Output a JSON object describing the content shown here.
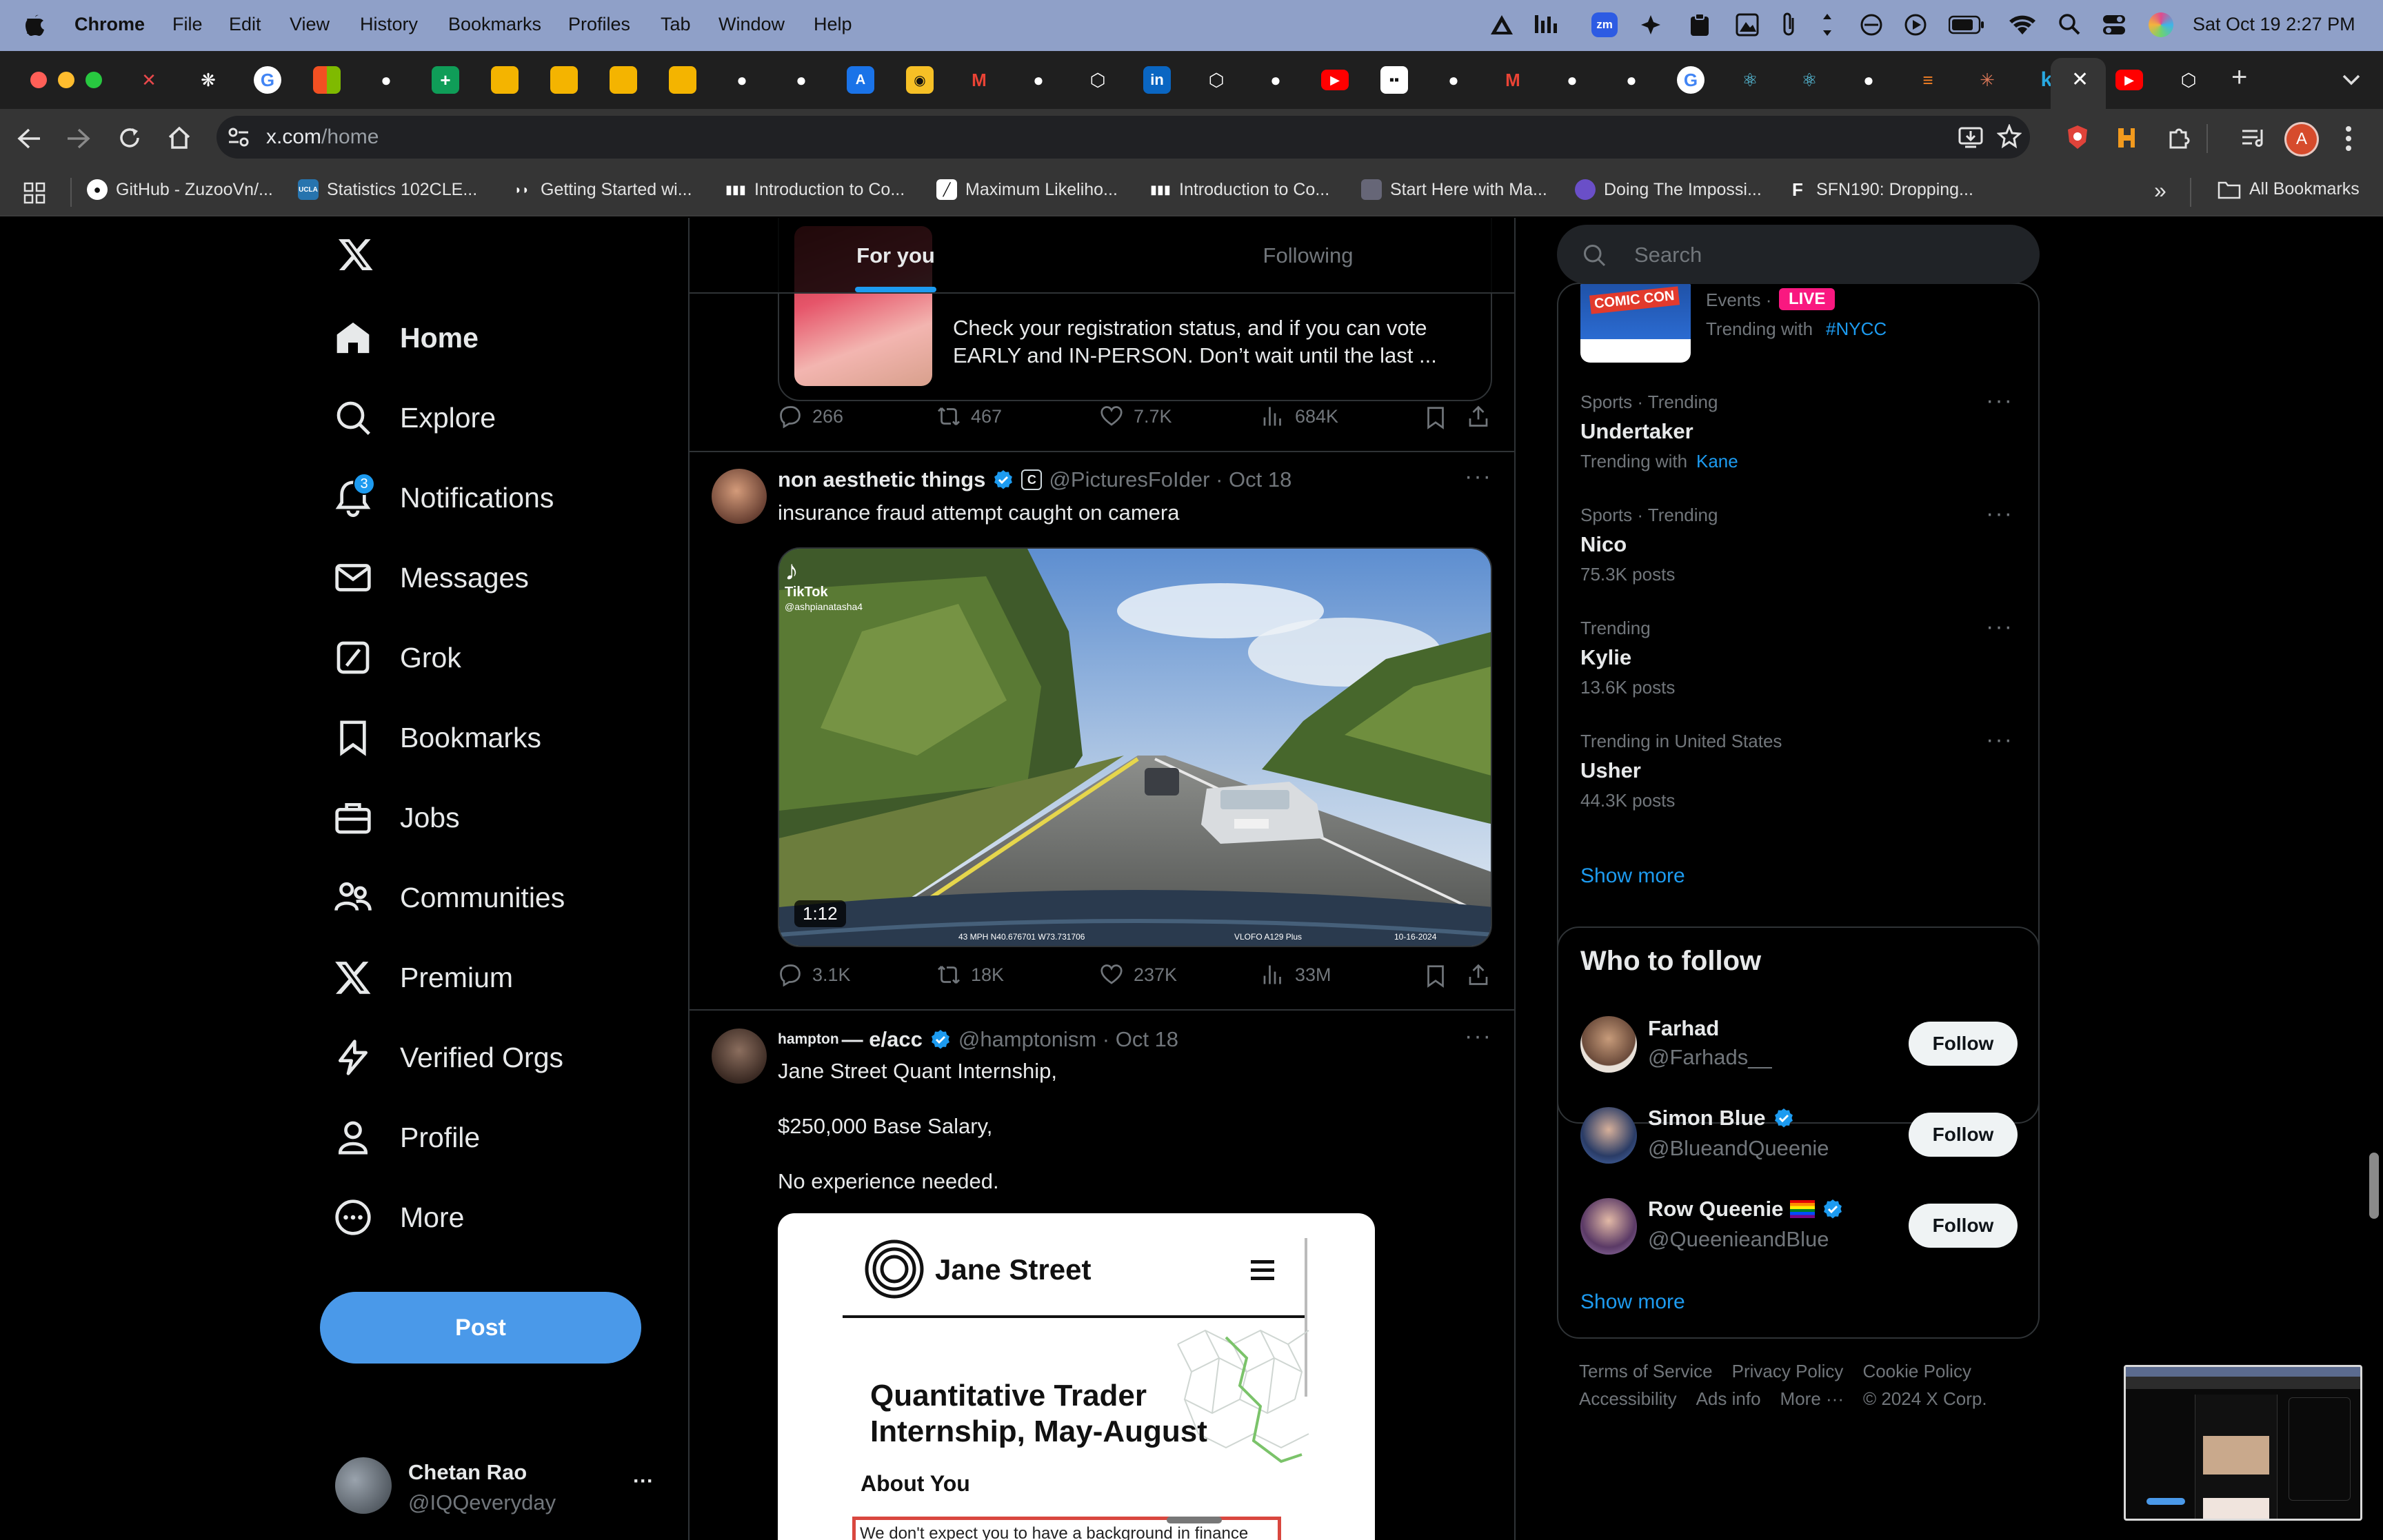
{
  "menubar": {
    "app": "Chrome",
    "menus": [
      "File",
      "Edit",
      "View",
      "History",
      "Bookmarks",
      "Profiles",
      "Tab",
      "Window",
      "Help"
    ],
    "datetime": "Sat Oct 19  2:27 PM",
    "zoom_badge": "zm"
  },
  "browser": {
    "url_host": "x.com",
    "url_path": "/home",
    "new_tab": "+",
    "profile_initial": "A",
    "all_bookmarks": "All Bookmarks",
    "bookmarks": [
      "GitHub - ZuzooVn/...",
      "Statistics 102CLE...",
      "Getting Started wi...",
      "Introduction to Co...",
      "Maximum Likeliho...",
      "Introduction to Co...",
      "Start Here with Ma...",
      "Doing The Impossi...",
      "SFN190: Dropping..."
    ],
    "bookmark_fav_letters": {
      "stats": "UCLA",
      "sfn": "F"
    }
  },
  "nav": {
    "items": [
      "Home",
      "Explore",
      "Notifications",
      "Messages",
      "Grok",
      "Bookmarks",
      "Jobs",
      "Communities",
      "Premium",
      "Verified Orgs",
      "Profile",
      "More"
    ],
    "notif_count": "3",
    "post_label": "Post",
    "account_name": "Chetan Rao",
    "account_handle": "@IQQeveryday",
    "account_more": "···"
  },
  "timeline": {
    "tabs": [
      "For you",
      "Following"
    ],
    "tweet0": {
      "card_text_1": "Check your registration status, and if you can vote",
      "card_text_2": "EARLY and IN-PERSON. Don’t wait until the last ...",
      "replies": "266",
      "retweets": "467",
      "likes": "7.7K",
      "views": "684K"
    },
    "tweet1": {
      "name": "non aesthetic things",
      "badge": "C",
      "handle_date": "@PicturesFoIder · Oct 18",
      "text": "insurance fraud attempt caught on camera",
      "video_duration": "1:12",
      "tiktok": "TikTok",
      "tiktok_user": "@ashpianatasha4",
      "dashcam": "43 MPH N40.676701 W73.731706",
      "dashcam_model": "VLOFO A129 Plus",
      "dashcam_date": "10-16-2024",
      "replies": "3.1K",
      "retweets": "18K",
      "likes": "237K",
      "views": "33M",
      "more": "···"
    },
    "tweet2": {
      "name_small": "hampton",
      "name_big": "— e/acc",
      "handle_date": "@hamptonism · Oct 18",
      "line1": "Jane Street Quant Internship,",
      "line2": "$250,000 Base Salary,",
      "line3": "No experience needed.",
      "card_brand": "Jane Street",
      "card_title_1": "Quantitative Trader",
      "card_title_2": "Internship, May-August",
      "card_about": "About You",
      "card_snippet": "We don't expect you to have a background in finance",
      "more": "···"
    }
  },
  "right": {
    "search_placeholder": "Search",
    "event_label": "Events ·",
    "live": "LIVE",
    "event_trending": "Trending with",
    "event_tag": "#NYCC",
    "event_logo_text": "COMIC CON",
    "trends": [
      {
        "meta": "Sports · Trending",
        "name": "Undertaker",
        "sub_prefix": "Trending with ",
        "sub_link": "Kane",
        "sub": ""
      },
      {
        "meta": "Sports · Trending",
        "name": "Nico",
        "sub_prefix": "",
        "sub_link": "",
        "sub": "75.3K posts"
      },
      {
        "meta": "Trending",
        "name": "Kylie",
        "sub_prefix": "",
        "sub_link": "",
        "sub": "13.6K posts"
      },
      {
        "meta": "Trending in United States",
        "name": "Usher",
        "sub_prefix": "",
        "sub_link": "",
        "sub": "44.3K posts"
      }
    ],
    "trend_more": "···",
    "show_more": "Show more",
    "wtf_title": "Who to follow",
    "follow": [
      {
        "name": "Farhad",
        "handle": "@Farhads__",
        "button": "Follow"
      },
      {
        "name": "Simon Blue",
        "handle": "@BlueandQueenie",
        "button": "Follow"
      },
      {
        "name": "Row Queenie",
        "handle": "@QueenieandBlue",
        "button": "Follow",
        "flag": "🏳️‍🌈"
      }
    ],
    "wtf_show_more": "Show more",
    "footer_1": [
      "Terms of Service",
      "Privacy Policy",
      "Cookie Policy"
    ],
    "footer_2": [
      "Accessibility",
      "Ads info",
      "More ···",
      "© 2024 X Corp."
    ]
  },
  "colors": {
    "accent": "#1d9bf0",
    "post_button": "#4a99e9",
    "live": "#f91880",
    "menubar": "#8fa0c8"
  }
}
